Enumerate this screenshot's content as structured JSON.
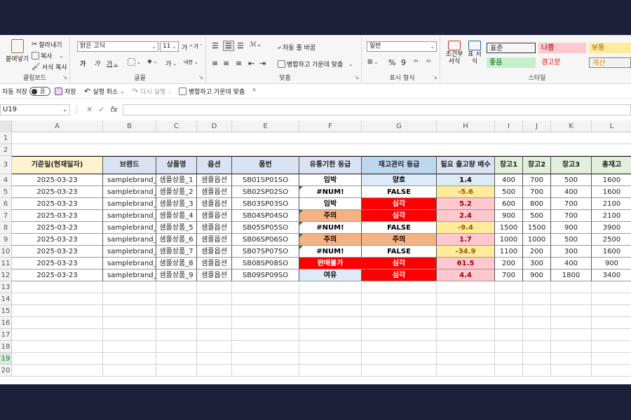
{
  "ribbon": {
    "clipboard": {
      "paste": "붙여넣기",
      "cut": "잘라내기",
      "copy": "복사",
      "format_painter": "서식 복사",
      "label": "클립보드"
    },
    "font": {
      "name": "맑은 고딕",
      "size": "11",
      "grow": "가",
      "shrink": "가",
      "bold": "가",
      "italic": "가",
      "underline": "가",
      "color": "가",
      "phonetic": "내천",
      "label": "글꼴"
    },
    "alignment": {
      "wrap": "자동 줄 바꿈",
      "merge": "병합하고 가운데 맞춤",
      "label": "맞춤"
    },
    "number": {
      "format": "일반",
      "percent": "%",
      "comma": "9",
      "label": "표시 형식"
    },
    "styles": {
      "conditional": "조건부 서식",
      "table": "표 서식",
      "label": "스타일",
      "cells": [
        {
          "text": "표준",
          "bg": "#ffffff",
          "fg": "#000000"
        },
        {
          "text": "나쁨",
          "bg": "#ffc7ce",
          "fg": "#9c0006"
        },
        {
          "text": "보통",
          "bg": "#ffeb9c",
          "fg": "#9c5700"
        },
        {
          "text": "좋음",
          "bg": "#c6efce",
          "fg": "#006100"
        },
        {
          "text": "경고문",
          "bg": "#ffffff",
          "fg": "#ff0000"
        },
        {
          "text": "계산",
          "bg": "#f2f2f2",
          "fg": "#fa7d00"
        }
      ]
    }
  },
  "qat": {
    "autosave": "자동 저장",
    "toggle": "끔",
    "save": "저장",
    "undo": "실행 취소",
    "redo": "다시 실행",
    "merge": "병합하고 가운데 맞춤"
  },
  "formula": {
    "cell_ref": "U19",
    "fx": "fx",
    "cancel": "✕",
    "enter": "✓"
  },
  "columns": [
    "A",
    "B",
    "C",
    "D",
    "E",
    "F",
    "G",
    "H",
    "I",
    "J",
    "K",
    "L"
  ],
  "row_numbers": [
    "1",
    "2",
    "3",
    "4",
    "5",
    "6",
    "7",
    "8",
    "9",
    "10",
    "11",
    "12",
    "13",
    "14",
    "15",
    "16",
    "17",
    "18",
    "19",
    "20"
  ],
  "headers": [
    "기준일(현재일자)",
    "브랜드",
    "상품명",
    "옵션",
    "품번",
    "유통기한 등급",
    "재고관리 등급",
    "필요 출고량 배수",
    "창고1",
    "창고2",
    "창고3",
    "총재고"
  ],
  "header_colors": [
    "#fff2cc",
    "#dae3f3",
    "#dae3f3",
    "#dae3f3",
    "#dae3f3",
    "#dae3f3",
    "#bdd7ee",
    "#dae3f3",
    "#e2efda",
    "#e2efda",
    "#e2efda",
    "#e2efda"
  ],
  "rows": [
    {
      "date": "2025-03-23",
      "brand": "samplebrand_1",
      "product": "샘플상품_1",
      "option": "샘플옵션",
      "sku": "SB01SP01SO",
      "expiry": "임박",
      "stock": "양호",
      "multiple": "1.4",
      "w1": "400",
      "w2": "700",
      "w3": "500",
      "total": "1600",
      "expiry_bg": "#ffffff",
      "stock_bg": "#ddebf7",
      "mult_bg": "#ddebf7",
      "mult_fg": "#000000",
      "stock_fg": "#000000",
      "expiry_fg": "#000000"
    },
    {
      "date": "2025-03-23",
      "brand": "samplebrand_1",
      "product": "샘플상품_2",
      "option": "샘플옵션",
      "sku": "SB02SP02SO",
      "expiry": "#NUM!",
      "stock": "FALSE",
      "multiple": "-5.6",
      "w1": "500",
      "w2": "700",
      "w3": "400",
      "total": "1600",
      "expiry_bg": "#ffffff",
      "stock_bg": "#ffffff",
      "mult_bg": "#ffeb9c",
      "mult_fg": "#9c5700",
      "stock_fg": "#000000",
      "expiry_fg": "#000000"
    },
    {
      "date": "2025-03-23",
      "brand": "samplebrand_1",
      "product": "샘플상품_3",
      "option": "샘플옵션",
      "sku": "SB03SP03SO",
      "expiry": "임박",
      "stock": "심각",
      "multiple": "5.2",
      "w1": "600",
      "w2": "800",
      "w3": "700",
      "total": "2100",
      "expiry_bg": "#ffffff",
      "stock_bg": "#ff0000",
      "mult_bg": "#ffc7ce",
      "mult_fg": "#9c0006",
      "stock_fg": "#ffffff",
      "expiry_fg": "#000000"
    },
    {
      "date": "2025-03-23",
      "brand": "samplebrand_2",
      "product": "샘플상품_4",
      "option": "샘플옵션",
      "sku": "SB04SP04SO",
      "expiry": "주의",
      "stock": "심각",
      "multiple": "2.4",
      "w1": "900",
      "w2": "500",
      "w3": "700",
      "total": "2100",
      "expiry_bg": "#f4b183",
      "stock_bg": "#ff0000",
      "mult_bg": "#ffc7ce",
      "mult_fg": "#9c0006",
      "stock_fg": "#ffffff",
      "expiry_fg": "#000000"
    },
    {
      "date": "2025-03-23",
      "brand": "samplebrand_2",
      "product": "샘플상품_5",
      "option": "샘플옵션",
      "sku": "SB05SP05SO",
      "expiry": "#NUM!",
      "stock": "FALSE",
      "multiple": "-9.4",
      "w1": "1500",
      "w2": "1500",
      "w3": "900",
      "total": "3900",
      "expiry_bg": "#ffffff",
      "stock_bg": "#ffffff",
      "mult_bg": "#ffeb9c",
      "mult_fg": "#9c5700",
      "stock_fg": "#000000",
      "expiry_fg": "#000000"
    },
    {
      "date": "2025-03-23",
      "brand": "samplebrand_2",
      "product": "샘플상품_6",
      "option": "샘플옵션",
      "sku": "SB06SP06SO",
      "expiry": "주의",
      "stock": "주의",
      "multiple": "1.7",
      "w1": "1000",
      "w2": "1000",
      "w3": "500",
      "total": "2500",
      "expiry_bg": "#f4b183",
      "stock_bg": "#f4b183",
      "mult_bg": "#ffc7ce",
      "mult_fg": "#9c0006",
      "stock_fg": "#000000",
      "expiry_fg": "#000000"
    },
    {
      "date": "2025-03-23",
      "brand": "samplebrand_3",
      "product": "샘플상품_7",
      "option": "샘플옵션",
      "sku": "SB07SP07SO",
      "expiry": "#NUM!",
      "stock": "FALSE",
      "multiple": "-34.9",
      "w1": "1100",
      "w2": "200",
      "w3": "300",
      "total": "1600",
      "expiry_bg": "#ffffff",
      "stock_bg": "#ffffff",
      "mult_bg": "#ffeb9c",
      "mult_fg": "#9c5700",
      "stock_fg": "#000000",
      "expiry_fg": "#000000"
    },
    {
      "date": "2025-03-23",
      "brand": "samplebrand_3",
      "product": "샘플상품_8",
      "option": "샘플옵션",
      "sku": "SB08SP08SO",
      "expiry": "판매불가",
      "stock": "심각",
      "multiple": "61.5",
      "w1": "200",
      "w2": "300",
      "w3": "400",
      "total": "900",
      "expiry_bg": "#ff0000",
      "stock_bg": "#ff0000",
      "mult_bg": "#ffc7ce",
      "mult_fg": "#9c0006",
      "stock_fg": "#ffffff",
      "expiry_fg": "#ffffff"
    },
    {
      "date": "2025-03-23",
      "brand": "samplebrand_3",
      "product": "샘플상품_9",
      "option": "샘플옵션",
      "sku": "SB09SP09SO",
      "expiry": "여유",
      "stock": "심각",
      "multiple": "4.4",
      "w1": "700",
      "w2": "900",
      "w3": "1800",
      "total": "3400",
      "expiry_bg": "#ddebf7",
      "stock_bg": "#ff0000",
      "mult_bg": "#ffc7ce",
      "mult_fg": "#9c0006",
      "stock_fg": "#ffffff",
      "expiry_fg": "#000000"
    }
  ],
  "selected_row": "19"
}
